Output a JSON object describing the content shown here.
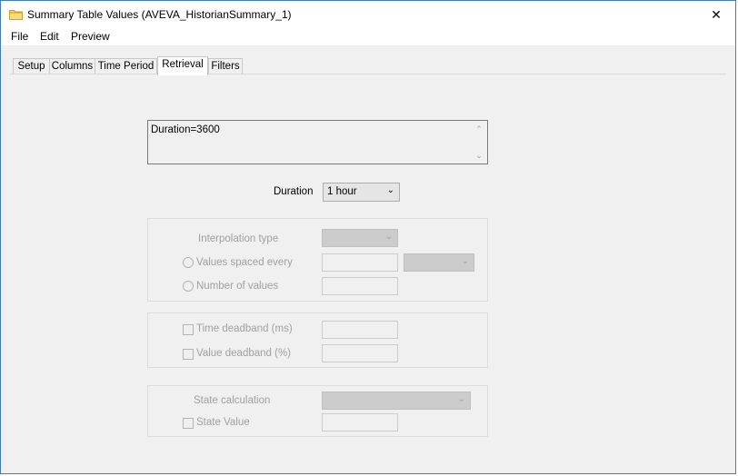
{
  "window": {
    "title": "Summary Table Values (AVEVA_HistorianSummary_1)",
    "close_glyph": "✕"
  },
  "menu": {
    "items": [
      "File",
      "Edit",
      "Preview"
    ]
  },
  "tabs": {
    "items": [
      "Setup",
      "Columns",
      "Time Period",
      "Retrieval",
      "Filters"
    ],
    "active": "Retrieval"
  },
  "retrieval": {
    "query_text": "Duration=3600",
    "duration_label": "Duration",
    "duration_value": "1 hour",
    "interpolation_type_label": "Interpolation type",
    "values_spaced_every_label": "Values spaced every",
    "number_of_values_label": "Number of values",
    "time_deadband_label": "Time deadband (ms)",
    "value_deadband_label": "Value deadband (%)",
    "state_calculation_label": "State calculation",
    "state_value_label": "State Value"
  },
  "colors": {
    "accent": "#3a7bd5",
    "disabled_text": "#a0a0a0"
  }
}
